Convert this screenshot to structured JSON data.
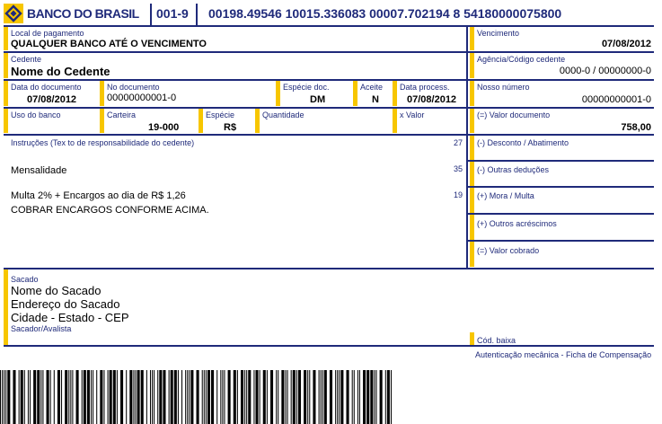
{
  "header": {
    "bank_name": "BANCO DO BRASIL",
    "bank_code": "001-9",
    "digitable_line": "00198.49546 10015.336083 00007.702194 8 54180000075800",
    "brand_color": "#1f2a7a",
    "accent_color": "#f7c600"
  },
  "row1": {
    "local_label": "Local de pagamento",
    "local_value": "QUALQUER BANCO ATÉ O VENCIMENTO",
    "venc_label": "Vencimento",
    "venc_value": "07/08/2012"
  },
  "row2": {
    "cedente_label": "Cedente",
    "cedente_value": "Nome do Cedente",
    "agencia_label": "Agência/Código cedente",
    "agencia_value": "0000-0 / 00000000-0"
  },
  "row3": {
    "data_doc_label": "Data do documento",
    "data_doc_value": "07/08/2012",
    "no_doc_label": "No documento",
    "no_doc_value": "00000000001-0",
    "especie_doc_label": "Espécie doc.",
    "especie_doc_value": "DM",
    "aceite_label": "Aceite",
    "aceite_value": "N",
    "data_proc_label": "Data process.",
    "data_proc_value": "07/08/2012",
    "nosso_label": "Nosso número",
    "nosso_value": "00000000001-0"
  },
  "row4": {
    "uso_label": "Uso do banco",
    "carteira_label": "Carteira",
    "carteira_value": "19-000",
    "especie_label": "Espécie",
    "especie_value": "R$",
    "qtd_label": "Quantidade",
    "xvalor_label": "x Valor",
    "valor_doc_label": "(=) Valor documento",
    "valor_doc_value": "758,00"
  },
  "instrucoes": {
    "label": "Instruções (Tex to de responsabilidade do cedente)",
    "line1": "Mensalidade",
    "line2": "Multa 2% + Encargos ao dia de R$ 1,26",
    "line3": "COBRAR ENCARGOS CONFORME ACIMA.",
    "num1": "27",
    "num2": "35",
    "num3": "19"
  },
  "right_fields": {
    "desconto": "(-) Desconto / Abatimento",
    "outras_deducoes": "(-) Outras deduções",
    "mora": "(+) Mora / Multa",
    "outros_acrescimos": "(+) Outros acréscimos",
    "valor_cobrado": "(=) Valor cobrado"
  },
  "sacado": {
    "label": "Sacado",
    "name": "Nome do Sacado",
    "address": "Endereço do Sacado",
    "city": "Cidade - Estado - CEP",
    "avalista_label": "Sacador/Avalista",
    "cod_baixa_label": "Cód. baixa",
    "autenticacao": "Autenticação mecânica - Ficha de Compensação"
  }
}
